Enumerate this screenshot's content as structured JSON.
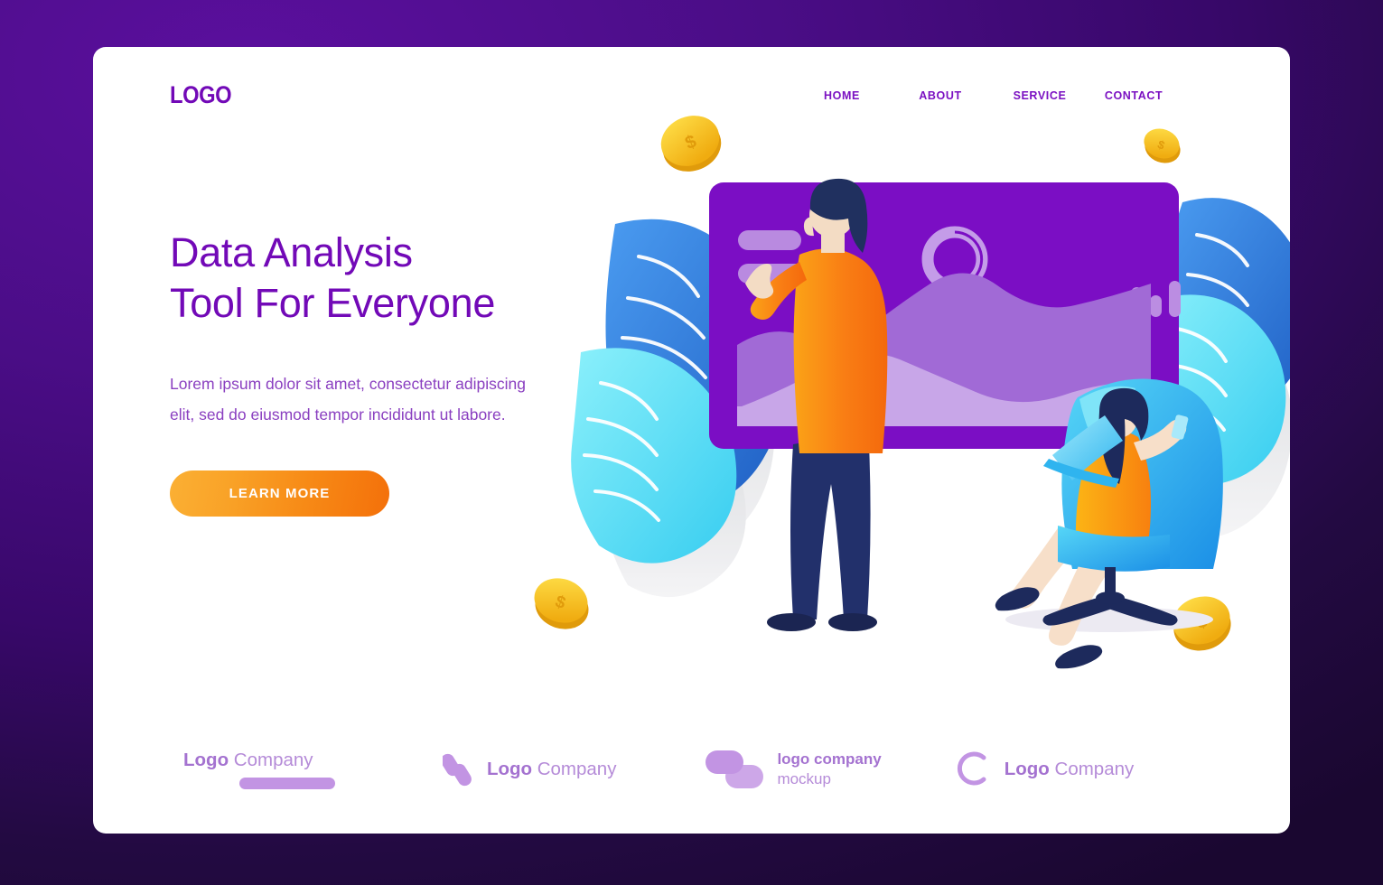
{
  "theme": {
    "background_purple": "#3b0a72",
    "brand_purple": "#7209b7",
    "accent_orange": "#f78a16",
    "footer_purple": "#b58bd8",
    "chair_blue": "#29a9f0",
    "leaf_blue": "#2b7fe0",
    "leaf_cyan": "#6fe3f5",
    "coin_gold": "#f5c518"
  },
  "header": {
    "logo": "LOGO",
    "nav": [
      {
        "label": "HOME",
        "name": "nav-home"
      },
      {
        "label": "ABOUT",
        "name": "nav-about"
      },
      {
        "label": "SERVICE",
        "name": "nav-service"
      },
      {
        "label": "CONTACT",
        "name": "nav-contact"
      }
    ]
  },
  "hero": {
    "headline": "Data Analysis\nTool For Everyone",
    "subtext": "Lorem ipsum dolor sit amet, consectetur adipiscing\nelit, sed do eiusmod tempor incididunt ut labore.",
    "cta_label": "LEARN MORE"
  },
  "illustration": {
    "alt": "Man presenting dashboard to woman seated in armchair",
    "dashboard": {
      "widgets": [
        "bar-label-short",
        "bar-label-long",
        "donut-chart",
        "bar-chart-indicator",
        "area-chart-wave-back",
        "area-chart-wave-front"
      ],
      "bar_indicator_heights": [
        7,
        26,
        19,
        33
      ]
    },
    "coins": [
      {
        "name": "coin-top-left",
        "symbol": "$"
      },
      {
        "name": "coin-top-right",
        "symbol": "$"
      },
      {
        "name": "coin-bottom-left",
        "symbol": "$"
      },
      {
        "name": "coin-bottom-right",
        "symbol": "$"
      }
    ],
    "people": [
      {
        "name": "presenter-man",
        "outfit": "orange jacket, navy trousers"
      },
      {
        "name": "seated-woman",
        "outfit": "orange dress, laptop"
      }
    ],
    "plants": [
      "leaf-blue-left",
      "leaf-cyan-left",
      "leaf-gray-left",
      "leaf-blue-right",
      "leaf-cyan-right",
      "leaf-gray-right"
    ]
  },
  "footer": {
    "logos": [
      {
        "name": "footer-logo-1",
        "bold": "Logo",
        "rest": " Company",
        "mark": "bar"
      },
      {
        "name": "footer-logo-2",
        "bold": "Logo",
        "rest": " Company",
        "mark": "diagonal-capsules"
      },
      {
        "name": "footer-logo-3",
        "bold": "logo company",
        "rest": "mockup",
        "mark": "overlapping-rounded-rects"
      },
      {
        "name": "footer-logo-4",
        "bold": "Logo",
        "rest": " Company",
        "mark": "c-ring"
      }
    ]
  }
}
